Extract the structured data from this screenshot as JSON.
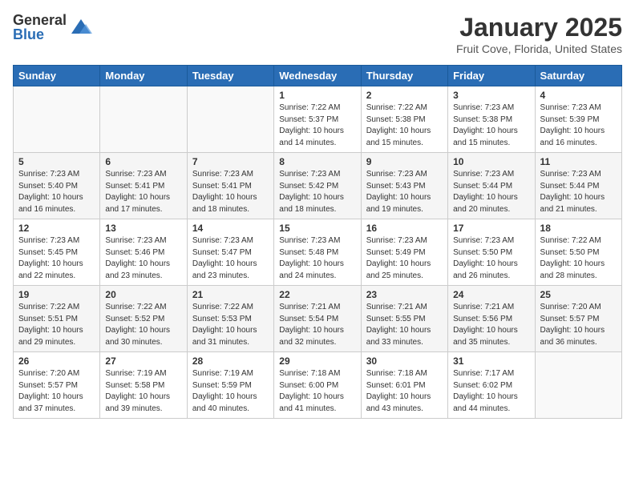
{
  "logo": {
    "general": "General",
    "blue": "Blue"
  },
  "title": "January 2025",
  "location": "Fruit Cove, Florida, United States",
  "weekdays": [
    "Sunday",
    "Monday",
    "Tuesday",
    "Wednesday",
    "Thursday",
    "Friday",
    "Saturday"
  ],
  "weeks": [
    [
      {
        "day": "",
        "info": ""
      },
      {
        "day": "",
        "info": ""
      },
      {
        "day": "",
        "info": ""
      },
      {
        "day": "1",
        "info": "Sunrise: 7:22 AM\nSunset: 5:37 PM\nDaylight: 10 hours\nand 14 minutes."
      },
      {
        "day": "2",
        "info": "Sunrise: 7:22 AM\nSunset: 5:38 PM\nDaylight: 10 hours\nand 15 minutes."
      },
      {
        "day": "3",
        "info": "Sunrise: 7:23 AM\nSunset: 5:38 PM\nDaylight: 10 hours\nand 15 minutes."
      },
      {
        "day": "4",
        "info": "Sunrise: 7:23 AM\nSunset: 5:39 PM\nDaylight: 10 hours\nand 16 minutes."
      }
    ],
    [
      {
        "day": "5",
        "info": "Sunrise: 7:23 AM\nSunset: 5:40 PM\nDaylight: 10 hours\nand 16 minutes."
      },
      {
        "day": "6",
        "info": "Sunrise: 7:23 AM\nSunset: 5:41 PM\nDaylight: 10 hours\nand 17 minutes."
      },
      {
        "day": "7",
        "info": "Sunrise: 7:23 AM\nSunset: 5:41 PM\nDaylight: 10 hours\nand 18 minutes."
      },
      {
        "day": "8",
        "info": "Sunrise: 7:23 AM\nSunset: 5:42 PM\nDaylight: 10 hours\nand 18 minutes."
      },
      {
        "day": "9",
        "info": "Sunrise: 7:23 AM\nSunset: 5:43 PM\nDaylight: 10 hours\nand 19 minutes."
      },
      {
        "day": "10",
        "info": "Sunrise: 7:23 AM\nSunset: 5:44 PM\nDaylight: 10 hours\nand 20 minutes."
      },
      {
        "day": "11",
        "info": "Sunrise: 7:23 AM\nSunset: 5:44 PM\nDaylight: 10 hours\nand 21 minutes."
      }
    ],
    [
      {
        "day": "12",
        "info": "Sunrise: 7:23 AM\nSunset: 5:45 PM\nDaylight: 10 hours\nand 22 minutes."
      },
      {
        "day": "13",
        "info": "Sunrise: 7:23 AM\nSunset: 5:46 PM\nDaylight: 10 hours\nand 23 minutes."
      },
      {
        "day": "14",
        "info": "Sunrise: 7:23 AM\nSunset: 5:47 PM\nDaylight: 10 hours\nand 23 minutes."
      },
      {
        "day": "15",
        "info": "Sunrise: 7:23 AM\nSunset: 5:48 PM\nDaylight: 10 hours\nand 24 minutes."
      },
      {
        "day": "16",
        "info": "Sunrise: 7:23 AM\nSunset: 5:49 PM\nDaylight: 10 hours\nand 25 minutes."
      },
      {
        "day": "17",
        "info": "Sunrise: 7:23 AM\nSunset: 5:50 PM\nDaylight: 10 hours\nand 26 minutes."
      },
      {
        "day": "18",
        "info": "Sunrise: 7:22 AM\nSunset: 5:50 PM\nDaylight: 10 hours\nand 28 minutes."
      }
    ],
    [
      {
        "day": "19",
        "info": "Sunrise: 7:22 AM\nSunset: 5:51 PM\nDaylight: 10 hours\nand 29 minutes."
      },
      {
        "day": "20",
        "info": "Sunrise: 7:22 AM\nSunset: 5:52 PM\nDaylight: 10 hours\nand 30 minutes."
      },
      {
        "day": "21",
        "info": "Sunrise: 7:22 AM\nSunset: 5:53 PM\nDaylight: 10 hours\nand 31 minutes."
      },
      {
        "day": "22",
        "info": "Sunrise: 7:21 AM\nSunset: 5:54 PM\nDaylight: 10 hours\nand 32 minutes."
      },
      {
        "day": "23",
        "info": "Sunrise: 7:21 AM\nSunset: 5:55 PM\nDaylight: 10 hours\nand 33 minutes."
      },
      {
        "day": "24",
        "info": "Sunrise: 7:21 AM\nSunset: 5:56 PM\nDaylight: 10 hours\nand 35 minutes."
      },
      {
        "day": "25",
        "info": "Sunrise: 7:20 AM\nSunset: 5:57 PM\nDaylight: 10 hours\nand 36 minutes."
      }
    ],
    [
      {
        "day": "26",
        "info": "Sunrise: 7:20 AM\nSunset: 5:57 PM\nDaylight: 10 hours\nand 37 minutes."
      },
      {
        "day": "27",
        "info": "Sunrise: 7:19 AM\nSunset: 5:58 PM\nDaylight: 10 hours\nand 39 minutes."
      },
      {
        "day": "28",
        "info": "Sunrise: 7:19 AM\nSunset: 5:59 PM\nDaylight: 10 hours\nand 40 minutes."
      },
      {
        "day": "29",
        "info": "Sunrise: 7:18 AM\nSunset: 6:00 PM\nDaylight: 10 hours\nand 41 minutes."
      },
      {
        "day": "30",
        "info": "Sunrise: 7:18 AM\nSunset: 6:01 PM\nDaylight: 10 hours\nand 43 minutes."
      },
      {
        "day": "31",
        "info": "Sunrise: 7:17 AM\nSunset: 6:02 PM\nDaylight: 10 hours\nand 44 minutes."
      },
      {
        "day": "",
        "info": ""
      }
    ]
  ]
}
